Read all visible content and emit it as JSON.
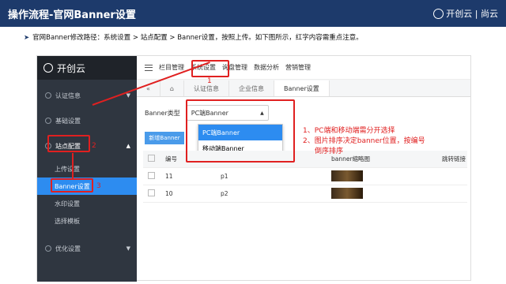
{
  "header": {
    "title": "操作流程-官网Banner设置",
    "brand": "开创云 | 尚云"
  },
  "instruction": "官网Banner修改路径：系统设置 > 站点配置 > Banner设置，按照上传。如下图所示，红字内容需重点注意。",
  "app": {
    "logo": "开创云",
    "sidebar": [
      {
        "label": "认证信息"
      },
      {
        "label": "基础设置"
      },
      {
        "label": "站点配置"
      }
    ],
    "sub_items": [
      {
        "label": "上传设置"
      },
      {
        "label": "Banner设置"
      },
      {
        "label": "水印设置"
      },
      {
        "label": "选择模板"
      }
    ],
    "sidebar_bottom": "优化设置",
    "menu": [
      "栏目管理",
      "系统设置",
      "询盘管理",
      "数据分析",
      "营销管理"
    ],
    "tabs": [
      "认证信息",
      "企业信息",
      "Banner设置"
    ],
    "filter_label": "Banner类型",
    "select_value": "PC端Banner",
    "options": [
      "PC端Banner",
      "移动端Banner"
    ],
    "new_button": "新增Banner",
    "columns": [
      "编号",
      "",
      "banner缩略图",
      "跳转链接"
    ],
    "rows": [
      {
        "id": "11",
        "name": "p1"
      },
      {
        "id": "10",
        "name": "p2"
      }
    ]
  },
  "annotations": {
    "n1": "1",
    "n2": "2",
    "n3": "3",
    "note1": "1、PC端和移动端需分开选择",
    "note2": "2、图片排序决定banner位置，按编号",
    "note3": "倒序排序"
  }
}
